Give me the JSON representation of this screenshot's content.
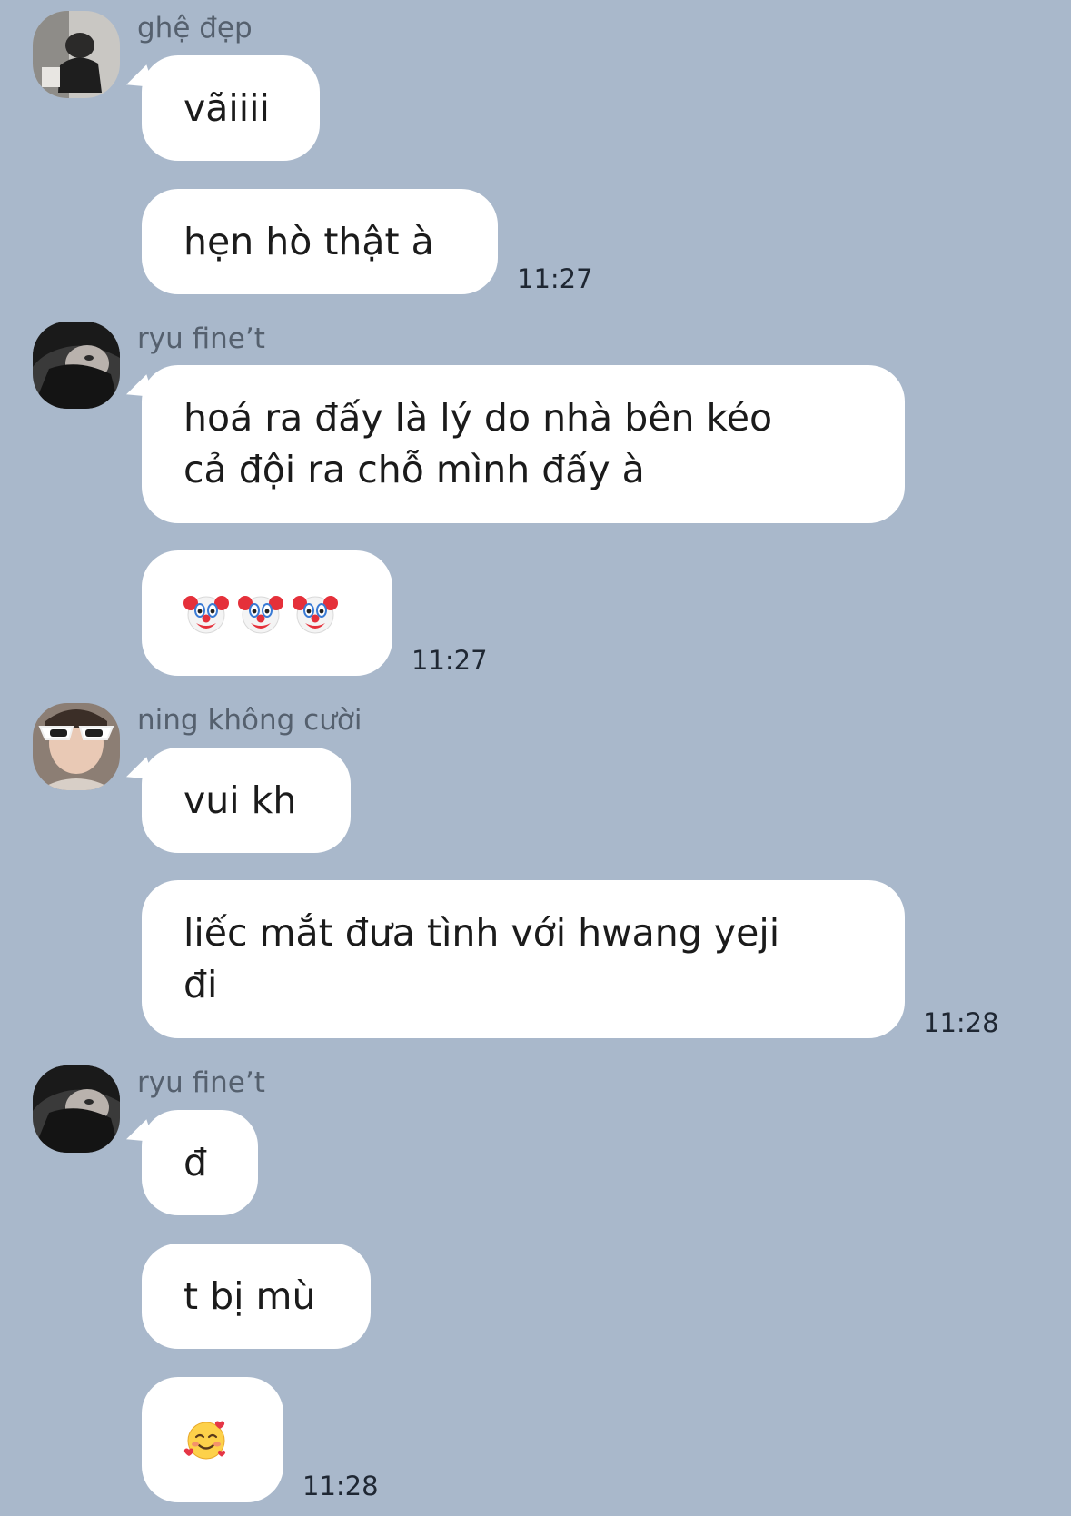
{
  "colors": {
    "background": "#a9b8cb",
    "bubble": "#ffffff",
    "sender_name": "#55606e"
  },
  "messages": [
    {
      "sender": "ghệ đẹp",
      "avatar": "avatar-photo",
      "bubbles": [
        "vãiiii",
        "hẹn hò thật à"
      ],
      "time": "11:27"
    },
    {
      "sender": "ryu fine’t",
      "avatar": "avatar-photo",
      "bubbles": [
        "hoá ra đấy là lý do nhà bên kéo\ncả đội ra chỗ mình đấy à",
        "clown-face-emoji ×3"
      ],
      "time": "11:27"
    },
    {
      "sender": "ning không cười",
      "avatar": "avatar-photo",
      "bubbles": [
        "vui kh",
        "liếc mắt đưa tình với hwang yeji\nđi"
      ],
      "time": "11:28"
    },
    {
      "sender": "ryu fine’t",
      "avatar": "avatar-photo",
      "bubbles": [
        "đ",
        "t bị mù",
        "smiling-face-with-hearts-emoji"
      ],
      "time": "11:28"
    }
  ]
}
